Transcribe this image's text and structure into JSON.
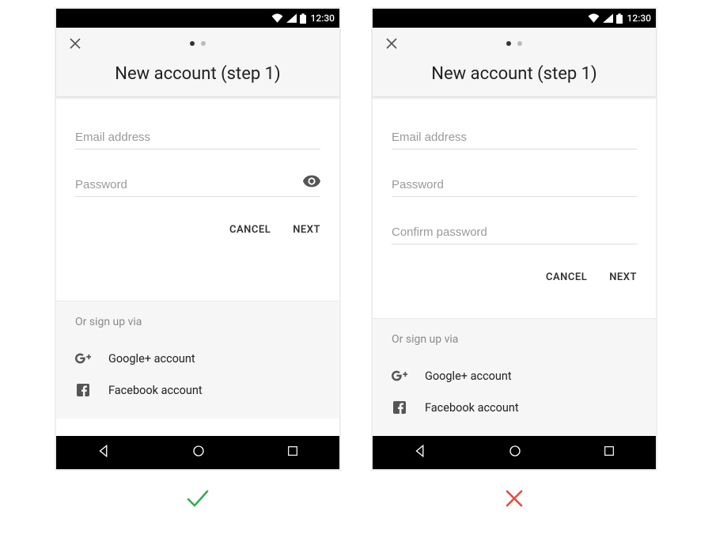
{
  "status": {
    "time": "12:30"
  },
  "appbar": {
    "title": "New account (step 1)",
    "pager": {
      "current": 1,
      "total": 2
    }
  },
  "form_a": {
    "email_placeholder": "Email address",
    "password_placeholder": "Password",
    "cancel_label": "CANCEL",
    "next_label": "NEXT"
  },
  "form_b": {
    "email_placeholder": "Email address",
    "password_placeholder": "Password",
    "confirm_placeholder": "Confirm password",
    "cancel_label": "CANCEL",
    "next_label": "NEXT"
  },
  "alt": {
    "title": "Or sign up via",
    "google_label": "Google+ account",
    "facebook_label": "Facebook account"
  },
  "verdict": {
    "left": "do",
    "right": "dont"
  }
}
